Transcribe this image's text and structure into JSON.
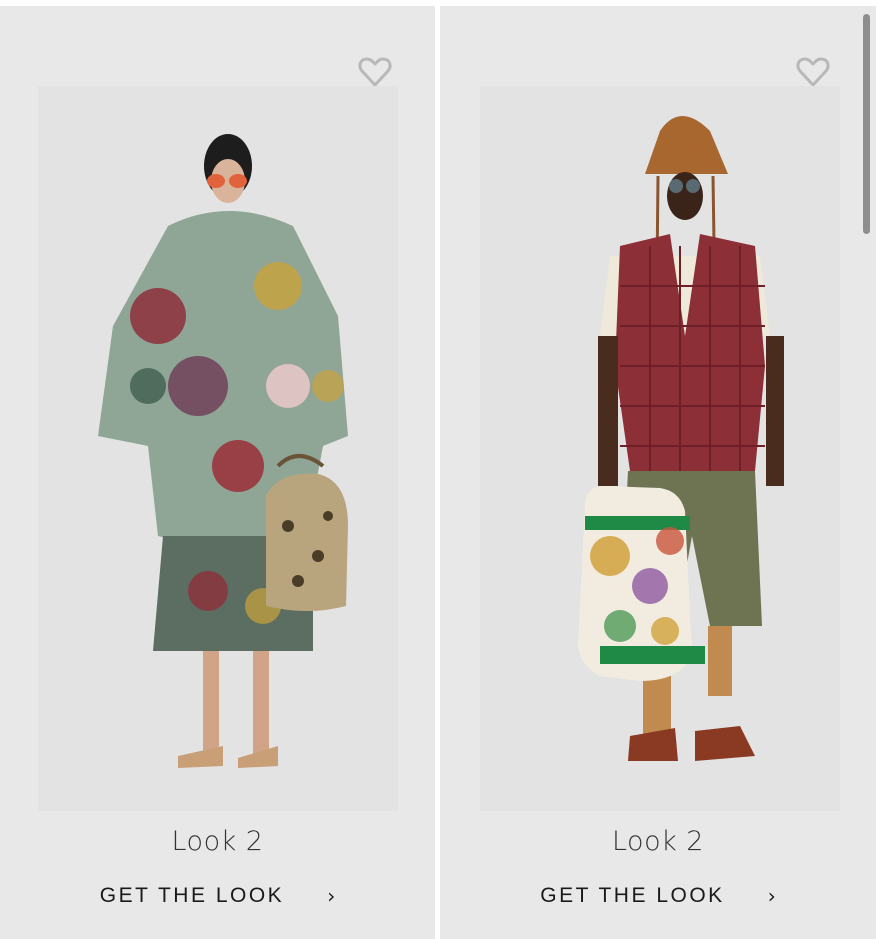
{
  "looks": [
    {
      "title": "Look 2",
      "cta_label": "GET THE LOOK",
      "favorite_icon": "heart-outline-icon",
      "cta_icon": "chevron-right-icon",
      "image": "model in floral puffer jacket with snakeskin bag"
    },
    {
      "title": "Look 2",
      "cta_label": "GET THE LOOK",
      "favorite_icon": "heart-outline-icon",
      "cta_icon": "chevron-right-icon",
      "image": "model in red check vest with floral backpack"
    }
  ],
  "colors": {
    "card_background": "#e8e8e8",
    "heart_stroke": "#b8b8b8",
    "text_primary": "#1a1a1a",
    "title_text": "#333333"
  },
  "chevron_glyph": "›"
}
